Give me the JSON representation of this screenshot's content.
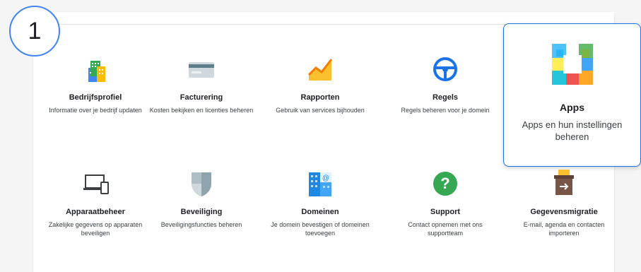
{
  "step_badge": "1",
  "tiles": [
    {
      "label": "Bedrijfsprofiel",
      "description": "Informatie over je bedrijf updaten",
      "icon": "building-icon"
    },
    {
      "label": "Facturering",
      "description": "Kosten bekijken en licenties beheren",
      "icon": "credit-card-icon"
    },
    {
      "label": "Rapporten",
      "description": "Gebruik van services bijhouden",
      "icon": "reports-chart-icon"
    },
    {
      "label": "Regels",
      "description": "Regels beheren voor je domein",
      "icon": "steering-wheel-icon"
    },
    {
      "label": "Apps",
      "description": "Apps en hun instellingen beheren",
      "icon": "apps-grid-icon"
    },
    {
      "label": "Apparaatbeheer",
      "description": "Zakelijke gegevens op apparaten beveiligen",
      "icon": "laptop-phone-icon"
    },
    {
      "label": "Beveiliging",
      "description": "Beveiligingsfuncties beheren",
      "icon": "shield-icon"
    },
    {
      "label": "Domeinen",
      "description": "Je domein bevestigen of domeinen toevoegen",
      "icon": "domain-building-icon"
    },
    {
      "label": "Support",
      "description": "Contact opnemen met ons supportteam",
      "icon": "help-question-icon"
    },
    {
      "label": "Gegevensmigratie",
      "description": "E-mail, agenda en contacten importeren",
      "icon": "archive-box-icon"
    }
  ],
  "colors": {
    "accent_blue": "#1a73e8",
    "badge_blue": "#4285f4",
    "support_green": "#34a853",
    "reports_orange": "#f9a825"
  }
}
